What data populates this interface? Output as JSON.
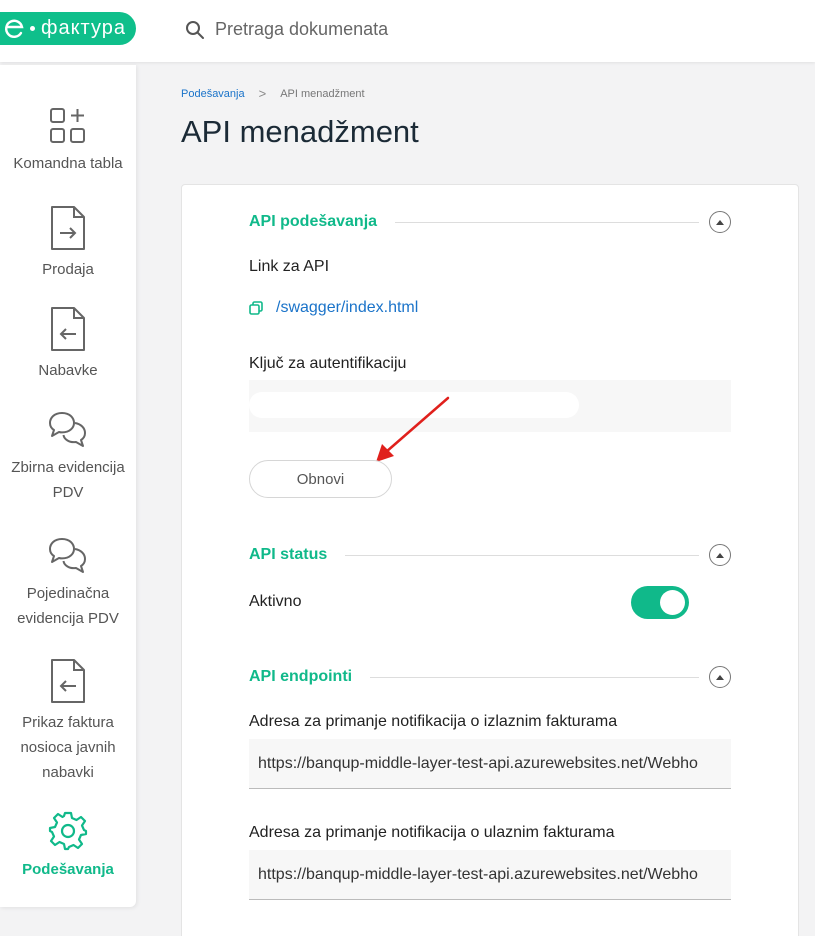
{
  "brand": {
    "logo_text": "фактура",
    "accent": "#10b98a"
  },
  "search": {
    "placeholder": "Pretraga dokumenata"
  },
  "sidebar": {
    "items": [
      {
        "label_lines": [
          "Komandna tabla"
        ],
        "icon": "dashboard-add-icon"
      },
      {
        "label_lines": [
          "Prodaja"
        ],
        "icon": "document-arrow-right-icon"
      },
      {
        "label_lines": [
          "Nabavke"
        ],
        "icon": "document-arrow-left-icon"
      },
      {
        "label_lines": [
          "Zbirna evidencija",
          "PDV"
        ],
        "icon": "chat-bubbles-icon"
      },
      {
        "label_lines": [
          "Pojedinačna",
          "evidencija PDV"
        ],
        "icon": "chat-bubbles-icon"
      },
      {
        "label_lines": [
          "Prikaz faktura",
          "nosioca javnih",
          "nabavki"
        ],
        "icon": "document-arrow-left-icon"
      },
      {
        "label_lines": [
          "Podešavanja"
        ],
        "icon": "gear-icon",
        "active": true
      }
    ]
  },
  "breadcrumb": {
    "parent": "Podešavanja",
    "separator": ">",
    "current": "API menadžment"
  },
  "page": {
    "title": "API menadžment"
  },
  "sections": {
    "settings": {
      "title": "API podešavanja",
      "link_label": "Link za API",
      "link_text": "/swagger/index.html",
      "key_label": "Ključ za autentifikaciju",
      "refresh_button": "Obnovi"
    },
    "status": {
      "title": "API status",
      "active_label": "Aktivno",
      "active": true
    },
    "endpoints": {
      "title": "API endpointi",
      "outgoing_label": "Adresa za primanje notifikacija o izlaznim fakturama",
      "outgoing_value": "https://banqup-middle-layer-test-api.azurewebsites.net/Webho",
      "incoming_label": "Adresa za primanje notifikacija o ulaznim fakturama",
      "incoming_value": "https://banqup-middle-layer-test-api.azurewebsites.net/Webho"
    }
  }
}
